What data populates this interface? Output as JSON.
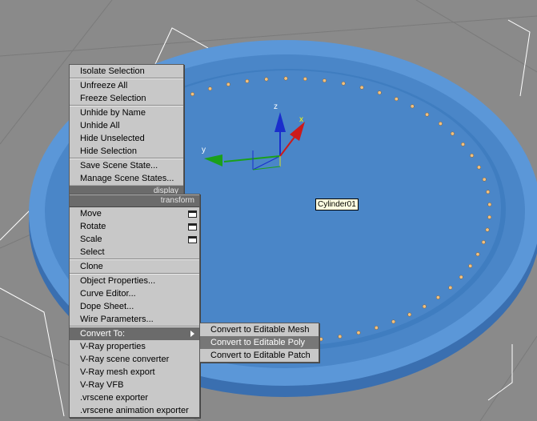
{
  "viewport": {
    "object_label": "Cylinder01",
    "axis_labels": {
      "x": "x",
      "y": "y",
      "z": "z"
    },
    "colors": {
      "background": "#8a8a8a",
      "object": "#4a86c8",
      "rim": "#5b97d8",
      "dots": "#f0c080"
    }
  },
  "menu": {
    "display_section": {
      "items": [
        "Isolate Selection",
        "Unfreeze All",
        "Freeze Selection",
        "Unhide by Name",
        "Unhide All",
        "Hide Unselected",
        "Hide Selection",
        "Save Scene State...",
        "Manage Scene States..."
      ],
      "header": "display"
    },
    "transform_section": {
      "header": "transform",
      "items": [
        "Move",
        "Rotate",
        "Scale",
        "Select",
        "Clone",
        "Object Properties...",
        "Curve Editor...",
        "Dope Sheet...",
        "Wire Parameters...",
        "Convert To:",
        "V-Ray properties",
        "V-Ray scene converter",
        "V-Ray mesh export",
        "V-Ray VFB",
        ".vrscene exporter",
        ".vrscene animation exporter"
      ]
    },
    "submenu": {
      "items": [
        "Convert to Editable Mesh",
        "Convert to Editable Poly",
        "Convert to Editable Patch"
      ]
    }
  }
}
